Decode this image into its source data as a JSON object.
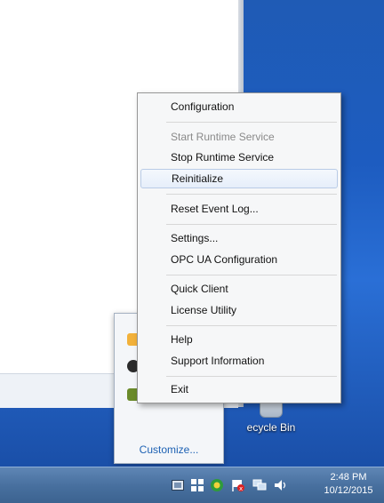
{
  "context_menu": {
    "items": [
      {
        "label": "Configuration",
        "enabled": true
      },
      {
        "label": "Start Runtime Service",
        "enabled": false
      },
      {
        "label": "Stop Runtime Service",
        "enabled": true
      },
      {
        "label": "Reinitialize",
        "enabled": true,
        "highlighted": true
      },
      {
        "label": "Reset Event Log...",
        "enabled": true
      },
      {
        "label": "Settings...",
        "enabled": true
      },
      {
        "label": "OPC UA Configuration",
        "enabled": true
      },
      {
        "label": "Quick Client",
        "enabled": true
      },
      {
        "label": "License Utility",
        "enabled": true
      },
      {
        "label": "Help",
        "enabled": true
      },
      {
        "label": "Support Information",
        "enabled": true
      },
      {
        "label": "Exit",
        "enabled": true
      }
    ]
  },
  "overflow_panel": {
    "customize_label": "Customize..."
  },
  "desktop": {
    "recycle_bin_label": "ecycle Bin"
  },
  "taskbar": {
    "tray_icons": [
      "show-desktop-icon",
      "windows-icon",
      "runtime-icon",
      "flag-icon",
      "network-icon",
      "speaker-icon"
    ],
    "clock_time": "2:48 PM",
    "clock_date": "10/12/2015"
  }
}
